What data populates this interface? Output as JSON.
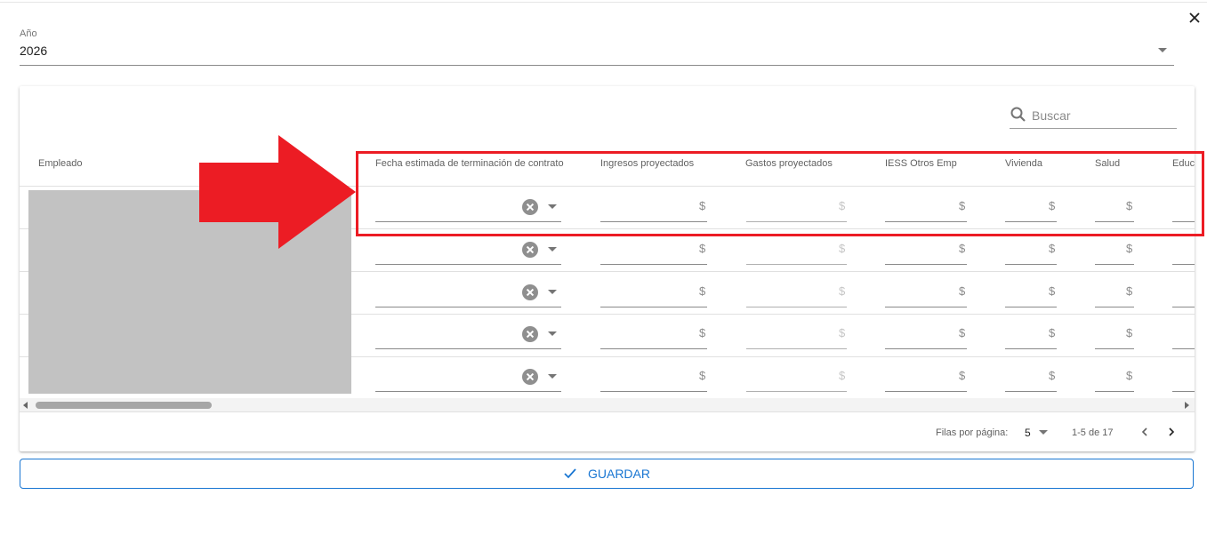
{
  "year": {
    "label": "Año",
    "value": "2026"
  },
  "search": {
    "placeholder": "Buscar"
  },
  "table": {
    "columns": [
      "Empleado",
      "Fecha estimada de terminación de contrato",
      "Ingresos proyectados",
      "Gastos proyectados",
      "IESS Otros Emp",
      "Vivienda",
      "Salud",
      "Educa"
    ],
    "currency_symbol": "$",
    "visible_rows": 5
  },
  "pagination": {
    "rows_per_page_label": "Filas por página:",
    "rows_per_page": "5",
    "range": "1-5 de 17"
  },
  "save_button": {
    "label": "GUARDAR"
  },
  "colors": {
    "accent": "#1976d2",
    "annotation": "#ec1c24",
    "redacted": "#c2c2c2"
  },
  "icons": [
    "close-icon",
    "dropdown-icon",
    "search-icon",
    "clear-icon",
    "chevron-left-icon",
    "chevron-right-icon",
    "check-icon",
    "arrow-annotation"
  ]
}
